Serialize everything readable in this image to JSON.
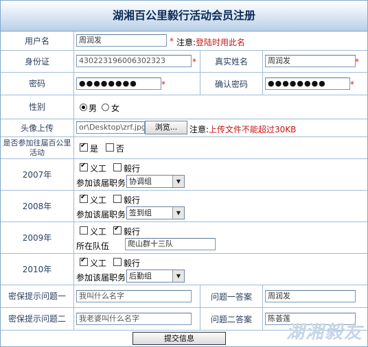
{
  "title": "湖湘百公里毅行活动会员注册",
  "username": {
    "label": "用户名",
    "value": "周润发",
    "note_prefix": "注意:",
    "note_red": "登陆时用此名"
  },
  "idcard": {
    "label": "身份证",
    "value": "430223196006302323"
  },
  "realname": {
    "label": "真实姓名",
    "value": "周润发"
  },
  "password": {
    "label": "密码",
    "value": "●●●●●●●●"
  },
  "confirm": {
    "label": "确认密码",
    "value": "●●●●●●●●"
  },
  "gender": {
    "label": "性别",
    "male": "男",
    "female": "女",
    "selected": "男"
  },
  "avatar": {
    "label": "头像上传",
    "path": "or\\Desktop\\zrf.jpg",
    "browse": "浏览...",
    "note_prefix": "注意:",
    "note_red": "上传文件不能超过30KB"
  },
  "past": {
    "label": "是否参加往届百公里活动",
    "yes": "是",
    "no": "否",
    "yes_checked": true,
    "no_checked": false
  },
  "years": [
    {
      "label": "2007年",
      "volunteer": "义工",
      "walker": "毅行",
      "vol_checked": true,
      "walk_checked": false,
      "field_label": "参加该届职务",
      "field_value": "协调组",
      "type": "select"
    },
    {
      "label": "2008年",
      "volunteer": "义工",
      "walker": "毅行",
      "vol_checked": true,
      "walk_checked": false,
      "field_label": "参加该届职务",
      "field_value": "签到组",
      "type": "select"
    },
    {
      "label": "2009年",
      "volunteer": "义工",
      "walker": "毅行",
      "vol_checked": false,
      "walk_checked": true,
      "field_label": "所在队伍",
      "field_value": "爬山群十三队",
      "type": "input"
    },
    {
      "label": "2010年",
      "volunteer": "义工",
      "walker": "毅行",
      "vol_checked": true,
      "walk_checked": false,
      "field_label": "参加该届职务",
      "field_value": "后勤组",
      "type": "select"
    }
  ],
  "q1": {
    "label": "密保提示问题一",
    "value": "我叫什么名字",
    "answer_label": "问题一答案",
    "answer": "周润发"
  },
  "q2": {
    "label": "密保提示问题二",
    "value": "我老婆叫什么名字",
    "answer_label": "问题二答案",
    "answer": "陈荟莲"
  },
  "submit": "提交信息",
  "watermark": "湖湘毅友"
}
